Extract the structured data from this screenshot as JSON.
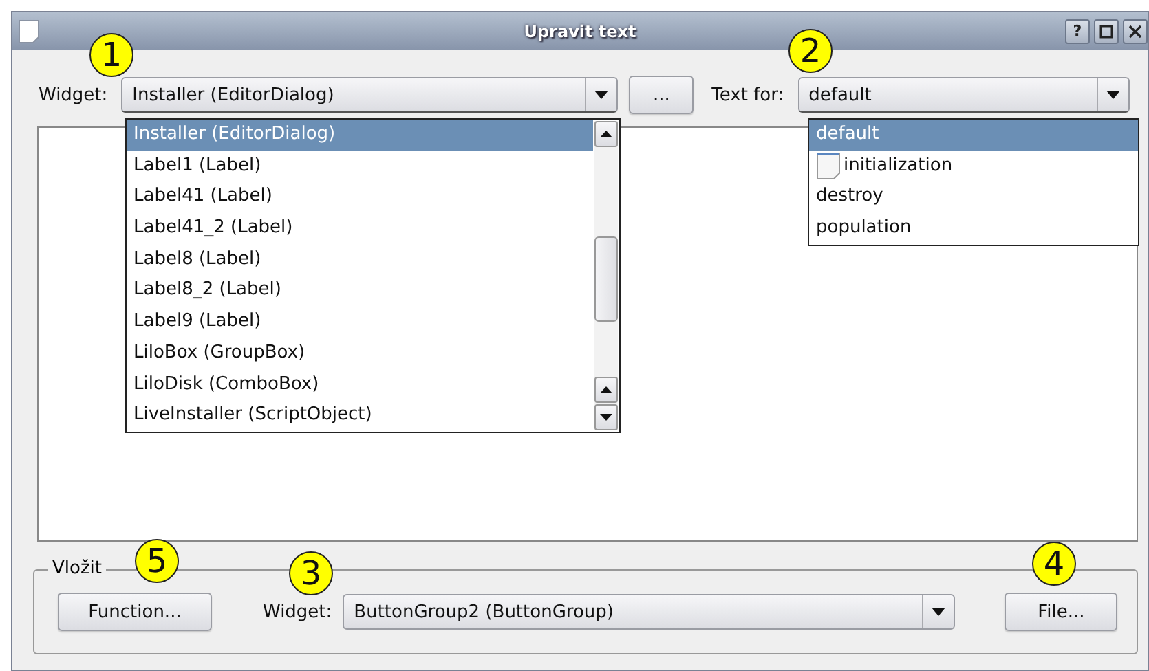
{
  "window": {
    "title": "Upravit text",
    "help_button": "?"
  },
  "top_row": {
    "widget_label": "Widget:",
    "widget_combo": {
      "value": "Installer (EditorDialog)",
      "expanded": true
    },
    "more_button": "...",
    "text_for_label": "Text for:",
    "text_for_combo": {
      "value": "default",
      "expanded": true
    }
  },
  "widget_list": [
    {
      "label": "Installer (EditorDialog)",
      "selected": true
    },
    {
      "label": "Label1 (Label)",
      "selected": false
    },
    {
      "label": "Label41 (Label)",
      "selected": false
    },
    {
      "label": "Label41_2 (Label)",
      "selected": false
    },
    {
      "label": "Label8 (Label)",
      "selected": false
    },
    {
      "label": "Label8_2 (Label)",
      "selected": false
    },
    {
      "label": "Label9 (Label)",
      "selected": false
    },
    {
      "label": "LiloBox (GroupBox)",
      "selected": false
    },
    {
      "label": "LiloDisk (ComboBox)",
      "selected": false
    },
    {
      "label": "LiveInstaller (ScriptObject)",
      "selected": false
    }
  ],
  "text_for_list": [
    {
      "label": "default",
      "selected": true,
      "kind": "plain"
    },
    {
      "label": "initialization",
      "selected": false,
      "kind": "document"
    },
    {
      "label": "destroy",
      "selected": false,
      "kind": "plain"
    },
    {
      "label": "population",
      "selected": false,
      "kind": "plain"
    }
  ],
  "insert_group": {
    "title": "Vložit",
    "function_button": "Function...",
    "widget_label": "Widget:",
    "widget_combo": {
      "value": "ButtonGroup2 (ButtonGroup)",
      "expanded": false
    },
    "file_button": "File..."
  },
  "callouts": [
    {
      "label": "1"
    },
    {
      "label": "2"
    },
    {
      "label": "5"
    },
    {
      "label": "3"
    },
    {
      "label": "4"
    }
  ]
}
